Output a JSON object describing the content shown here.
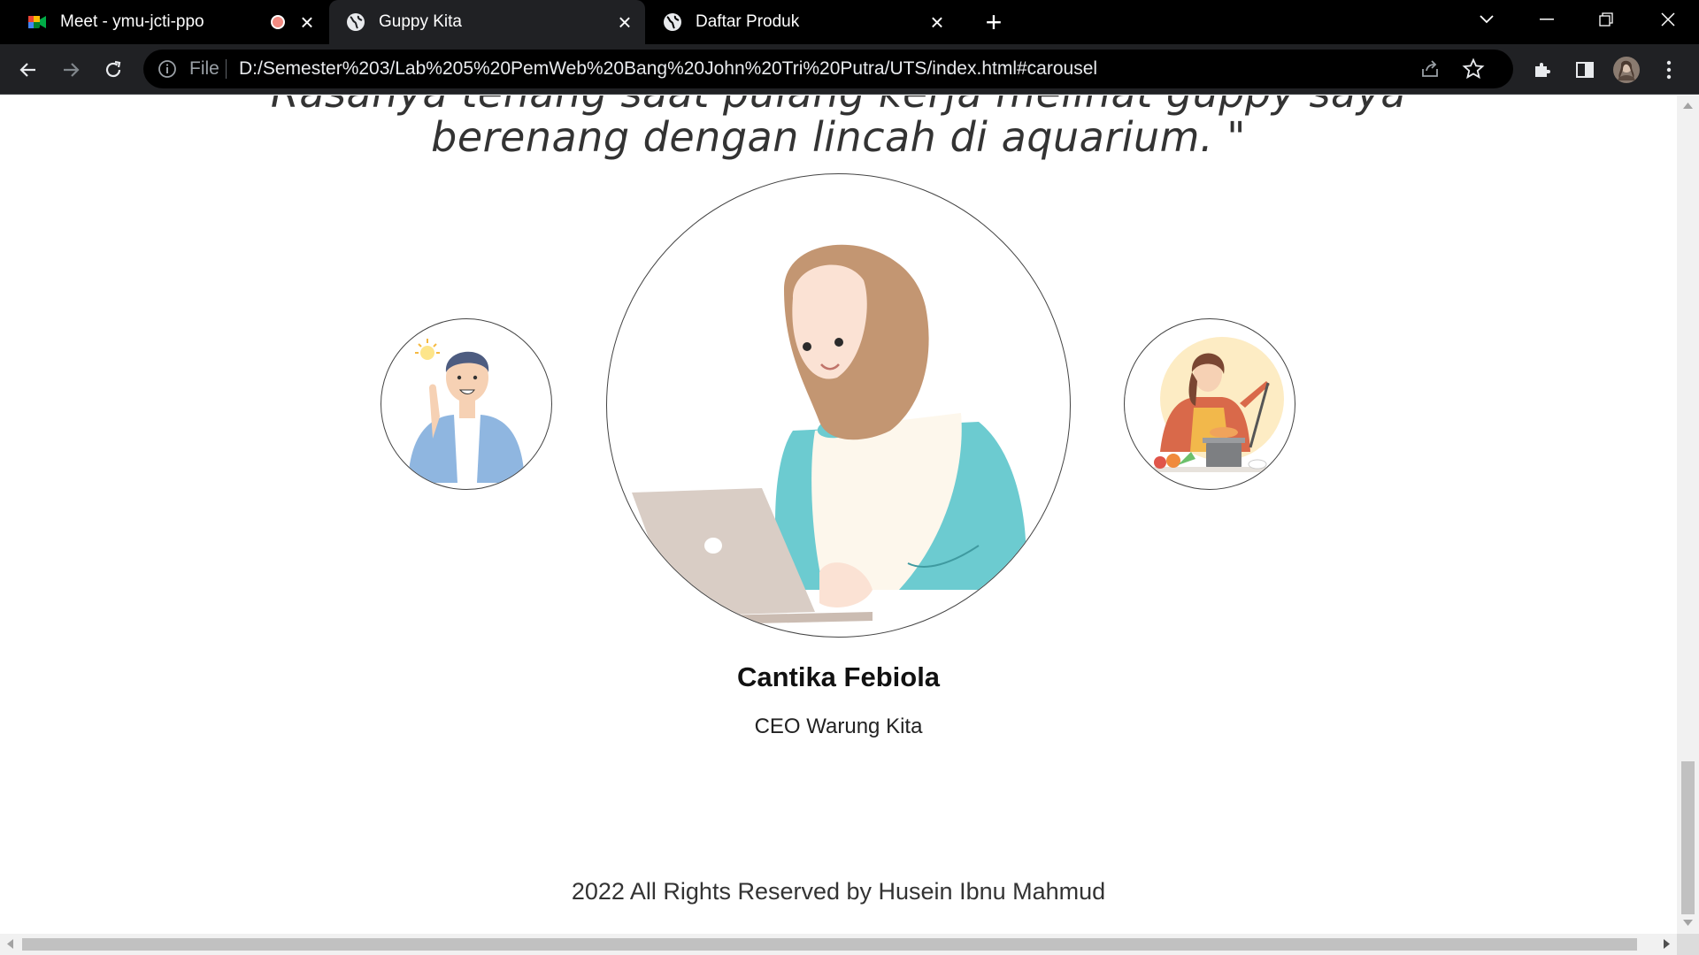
{
  "tabs": [
    {
      "title": "Meet - ymu-jcti-ppo",
      "icon": "google-meet-icon",
      "recording": true,
      "active": false
    },
    {
      "title": "Guppy Kita",
      "icon": "globe-icon",
      "active": true
    },
    {
      "title": "Daftar Produk",
      "icon": "globe-icon",
      "active": false
    }
  ],
  "toolbar": {
    "file_label": "File",
    "url": "D:/Semester%203/Lab%205%20PemWeb%20Bang%20John%20Tri%20Putra/UTS/index.html#carousel"
  },
  "testimonial": {
    "quote_line1": "Rasanya tenang saat pulang kerja melihat guppy saya",
    "quote_line2": "berenang dengan lincah di aquarium. \"",
    "name": "Cantika Febiola",
    "role": "CEO Warung Kita"
  },
  "footer": {
    "text": "2022 All Rights Reserved by Husein Ibnu Mahmud"
  },
  "colors": {
    "hijab": "#c39672",
    "sleeve": "#6ccbd0",
    "vest": "#fdf7ec",
    "laptop": "#d9cdc5",
    "jacket": "#8fb6e0"
  }
}
